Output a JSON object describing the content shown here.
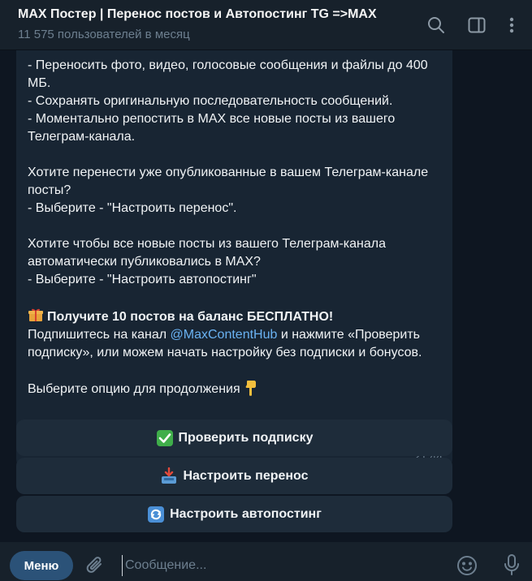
{
  "header": {
    "title": "MAX Постер | Перенос постов и Автопостинг TG =>MAX",
    "subtitle": "11 575 пользователей в месяц",
    "icons": [
      "search-icon",
      "sidebar-toggle-icon",
      "more-vert-icon"
    ]
  },
  "message": {
    "lines": {
      "l1": "- Переносить фото, видео, голосовые сообщения и файлы до 400 МБ.",
      "l2": "- Сохранять оригинальную последовательность сообщений.",
      "l3": "- Моментально репостить в MAX все новые посты из вашего Телеграм-канала.",
      "q1": "Хотите перенести уже опубликованные в вашем Телеграм-канале посты?",
      "a1": "- Выберите - \"Настроить перенос\".",
      "q2": "Хотите чтобы все новые посты из вашего Телеграм-канала автоматически публиковались в MAX?",
      "a2": "- Выберите - \"Настроить автопостинг\"",
      "promo": "Получите 10 постов на баланс БЕСПЛАТНО!",
      "sub_prefix": "Подпишитесь на канал ",
      "sub_link": "@MaxContentHub",
      "sub_suffix": " и нажмите «Проверить подписку», или можем начать настройку без подписки и бонусов.",
      "choose": "Выберите опцию для продолжения"
    },
    "time": "21:44"
  },
  "keyboard": {
    "check": "Проверить подписку",
    "transfer": "Настроить перенос",
    "autopost": "Настроить автопостинг"
  },
  "composer": {
    "menu_label": "Меню",
    "placeholder": "Сообщение..."
  },
  "colors": {
    "background": "#0e1621",
    "header": "#17212b",
    "bubble": "#182533",
    "button": "#1e2c3a",
    "link": "#6ab2f2",
    "menu": "#2b5278",
    "muted": "#6d7f8f"
  }
}
